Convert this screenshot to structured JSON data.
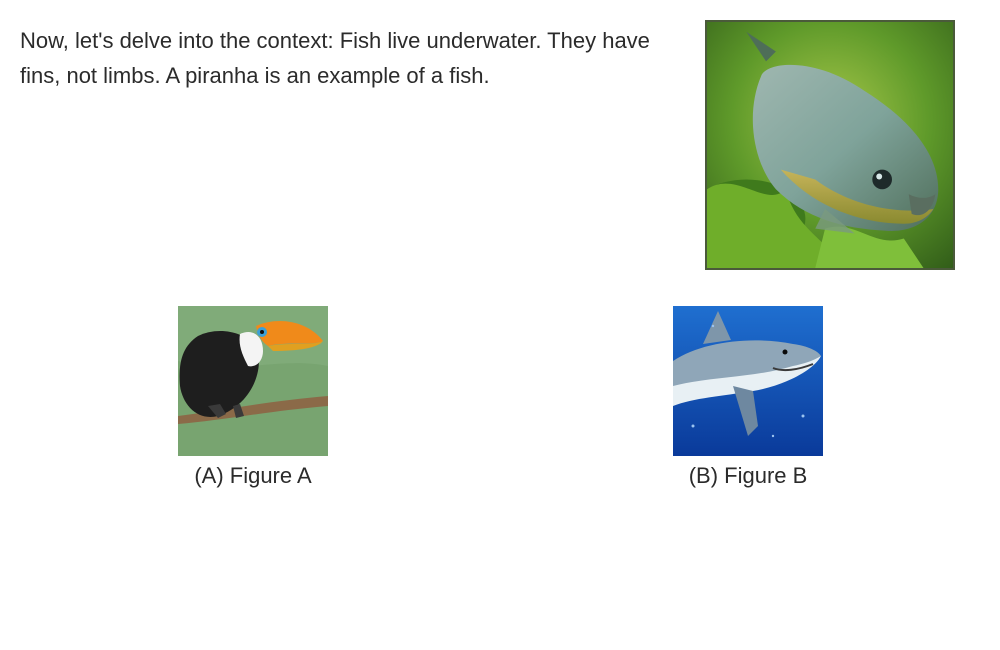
{
  "question": {
    "context_text": "Now, let's delve into the context: Fish live underwater. They have fins, not limbs. A piranha is an example of a fish."
  },
  "hero_image": {
    "subject": "piranha-image"
  },
  "options": [
    {
      "label": "(A) Figure A",
      "image": "toucan-image"
    },
    {
      "label": "(B) Figure B",
      "image": "shark-image"
    }
  ]
}
